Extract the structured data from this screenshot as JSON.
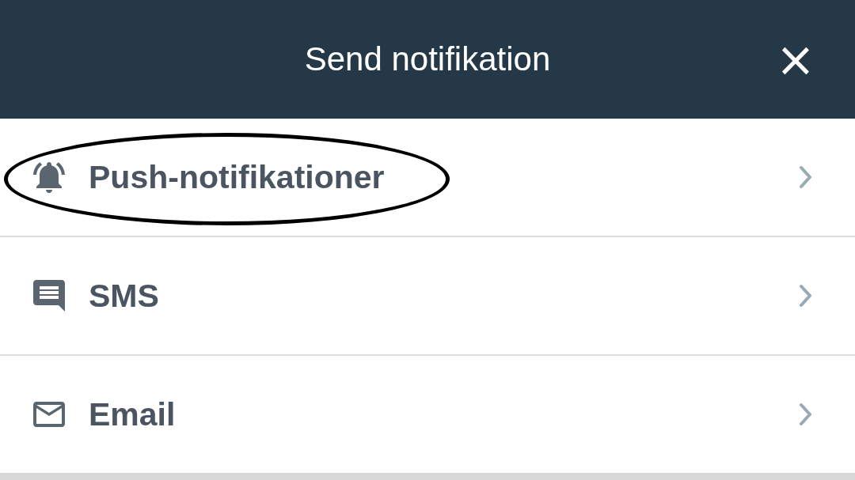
{
  "header": {
    "title": "Send notifikation",
    "close": "×"
  },
  "options": [
    {
      "kind": "bell",
      "label": "Push-notifikationer",
      "circled": true
    },
    {
      "kind": "message",
      "label": "SMS",
      "circled": false
    },
    {
      "kind": "mail",
      "label": "Email",
      "circled": false
    }
  ]
}
